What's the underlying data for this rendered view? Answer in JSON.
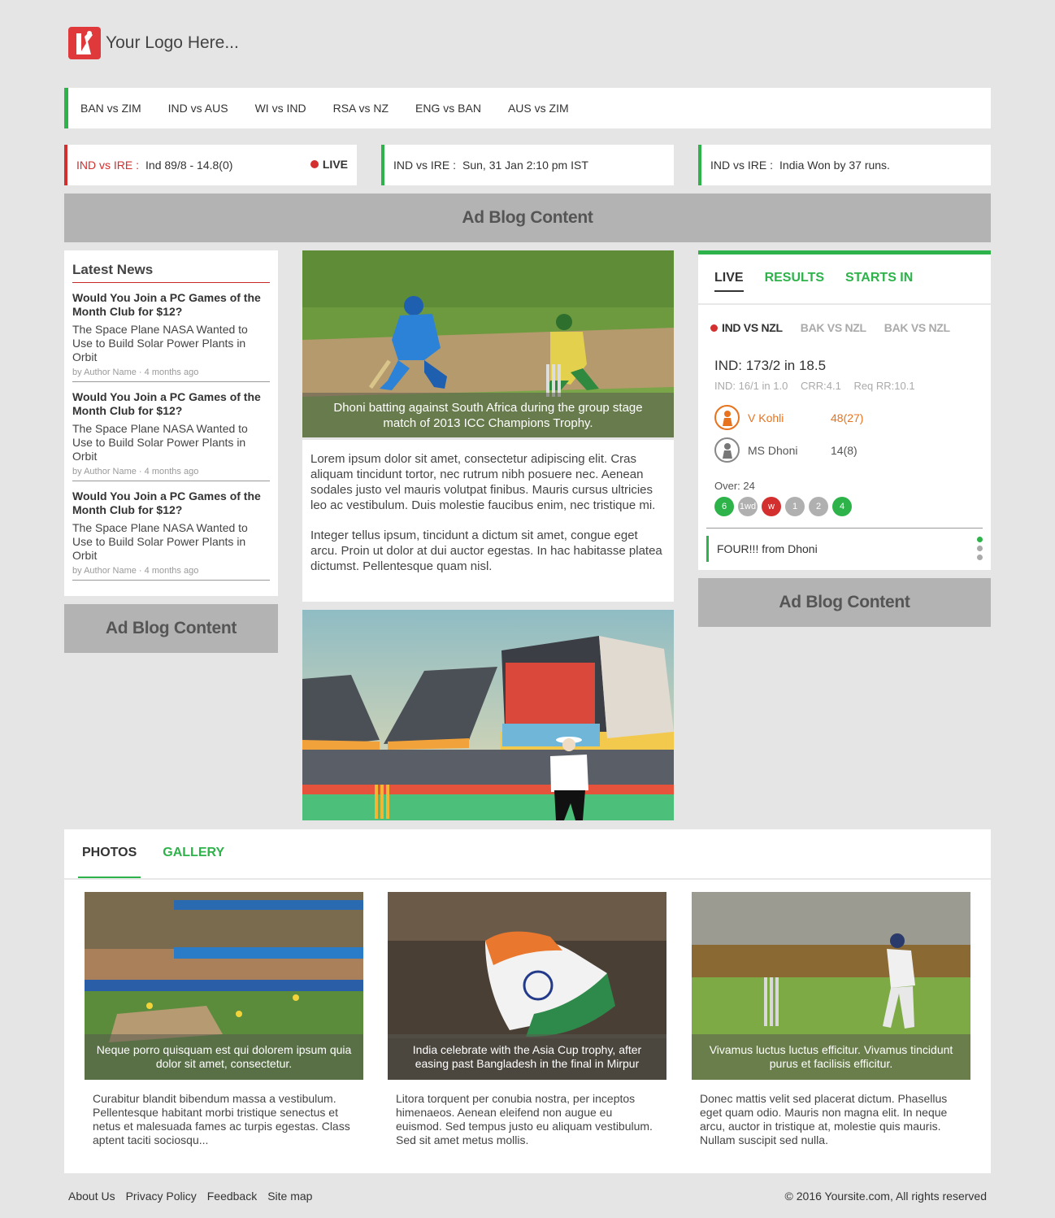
{
  "logo": {
    "text": "Your Logo Here..."
  },
  "match_nav": [
    "BAN vs ZIM",
    "IND vs AUS",
    "WI vs IND",
    "RSA vs NZ",
    "ENG vs BAN",
    "AUS vs ZIM"
  ],
  "score_cards": [
    {
      "team": "IND vs IRE :",
      "status": "Ind 89/8 - 14.8(0)",
      "badge": "LIVE"
    },
    {
      "team": "IND vs IRE :",
      "status": "Sun, 31 Jan 2:10 pm IST"
    },
    {
      "team": "IND vs IRE :",
      "status": "India Won by 37 runs."
    }
  ],
  "ads": {
    "top": "Ad Blog Content",
    "left": "Ad Blog Content",
    "right": "Ad Blog Content"
  },
  "latest_news": {
    "title": "Latest News",
    "items": [
      {
        "headline": "Would You Join a PC Games of the Month Club for $12?",
        "summary": "The Space Plane NASA Wanted to Use to Build Solar Power Plants in Orbit",
        "meta": "by Author Name · 4 months ago"
      },
      {
        "headline": "Would You Join a PC Games of the Month Club for $12?",
        "summary": "The Space Plane NASA Wanted to Use to Build Solar Power Plants in Orbit",
        "meta": "by Author Name · 4 months ago"
      },
      {
        "headline": "Would You Join a PC Games of the Month Club for $12?",
        "summary": "The Space Plane NASA Wanted to Use to Build Solar Power Plants in Orbit",
        "meta": "by Author Name · 4 months ago"
      }
    ]
  },
  "article": {
    "hero_caption": "Dhoni batting against South Africa during the group stage match of 2013 ICC Champions Trophy.",
    "paragraphs": [
      "Lorem ipsum dolor sit amet, consectetur adipiscing elit. Cras aliquam tincidunt tortor, nec rutrum nibh posuere nec. Aenean sodales justo vel mauris volutpat finibus. Mauris cursus ultricies leo ac vestibulum. Duis molestie faucibus enim, nec tristique mi.",
      "Integer tellus ipsum, tincidunt a dictum sit amet, congue eget arcu. Proin ut dolor at dui auctor egestas. In hac habitasse platea dictumst. Pellentesque quam nisl."
    ]
  },
  "live_widget": {
    "tabs": [
      "LIVE",
      "RESULTS",
      "STARTS IN"
    ],
    "matches": [
      "IND VS NZL",
      "BAK VS NZL",
      "BAK VS NZL"
    ],
    "score": "IND: 173/2 in 18.5",
    "detail": {
      "prev": "IND: 16/1 in 1.0",
      "crr": "CRR:4.1",
      "req": "Req RR:10.1"
    },
    "batsmen": [
      {
        "name": "V Kohli",
        "score": "48(27)",
        "color": "#e8731e"
      },
      {
        "name": "MS Dhoni",
        "score": "14(8)",
        "color": "#555555"
      }
    ],
    "over_label": "Over: 24",
    "balls": [
      {
        "label": "6",
        "color": "#2db34a"
      },
      {
        "label": "1wd",
        "color": "#b0b0b0"
      },
      {
        "label": "w",
        "color": "#d32f2f"
      },
      {
        "label": "1",
        "color": "#b0b0b0"
      },
      {
        "label": "2",
        "color": "#b0b0b0"
      },
      {
        "label": "4",
        "color": "#2db34a"
      }
    ],
    "commentary": "FOUR!!! from Dhoni"
  },
  "photos": {
    "tabs": [
      "PHOTOS",
      "GALLERY"
    ],
    "cards": [
      {
        "caption": "Neque porro quisquam est qui dolorem ipsum quia dolor sit amet, consectetur.",
        "text": "Curabitur blandit bibendum massa a vestibulum. Pellentesque habitant morbi tristique senectus et netus et malesuada fames ac turpis egestas. Class aptent taciti sociosqu..."
      },
      {
        "caption": "India celebrate with the Asia Cup trophy, after easing past Bangladesh in the final in Mirpur",
        "text": "Litora torquent per conubia nostra, per inceptos himenaeos. Aenean eleifend non augue eu euismod. Sed tempus justo eu aliquam vestibulum. Sed sit amet metus mollis."
      },
      {
        "caption": "Vivamus luctus luctus efficitur. Vivamus tincidunt purus et facilisis efficitur.",
        "text": "Donec mattis velit sed placerat dictum. Phasellus eget quam odio. Mauris non magna elit. In neque arcu, auctor in tristique at, molestie quis mauris. Nullam suscipit sed nulla."
      }
    ]
  },
  "footer": {
    "links": [
      "About Us",
      "Privacy Policy",
      "Feedback",
      "Site map"
    ],
    "copyright": "© 2016 Yoursite.com, All rights reserved"
  },
  "colors": {
    "accent": "#2db34a",
    "live": "#d32f2f",
    "ad": "#b3b3b3"
  }
}
